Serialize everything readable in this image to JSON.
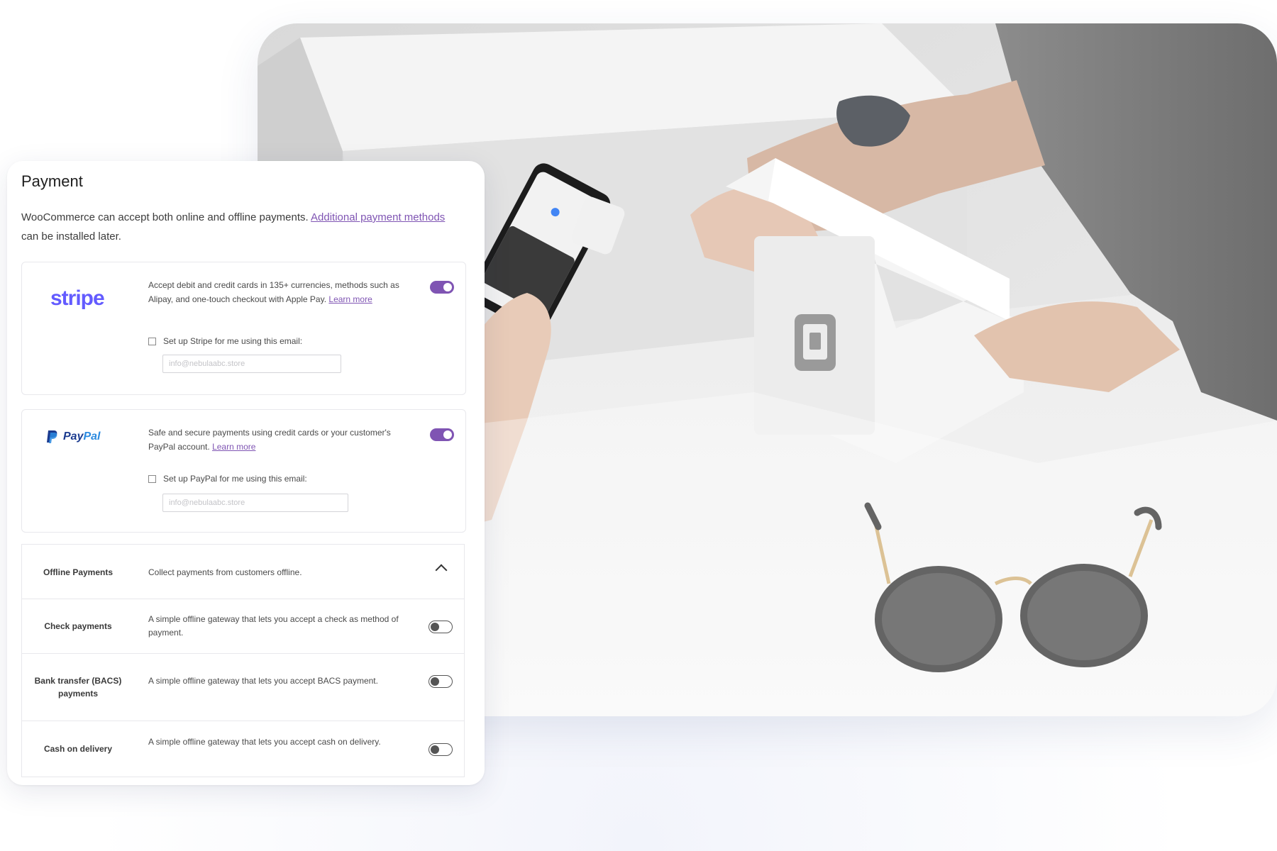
{
  "payment": {
    "title": "Payment",
    "intro_text": "WooCommerce can accept both online and offline payments.",
    "intro_link": "Additional payment methods",
    "intro_suffix": "can be installed later."
  },
  "stripe": {
    "logo": "stripe",
    "description": "Accept debit and credit cards in 135+ currencies, methods such as Alipay, and one-touch checkout with Apple Pay.",
    "learn_more": "Learn more",
    "enabled": true,
    "setup_label": "Set up Stripe for me using this email:",
    "email_placeholder": "info@nebulaabc.store"
  },
  "paypal": {
    "logo_pay": "Pay",
    "logo_pal": "Pal",
    "description": "Safe and secure payments using credit cards or your customer's PayPal account.",
    "learn_more": "Learn more",
    "enabled": true,
    "setup_label": "Set up PayPal for me using this email:",
    "email_placeholder": "info@nebulaabc.store"
  },
  "offline": {
    "label": "Offline Payments",
    "description": "Collect payments from customers offline.",
    "methods": [
      {
        "label": "Check payments",
        "description": "A simple offline gateway that lets you accept a check as method of payment.",
        "enabled": false
      },
      {
        "label": "Bank transfer (BACS) payments",
        "description": "A simple offline gateway that lets you accept BACS payment.",
        "enabled": false
      },
      {
        "label": "Cash on delivery",
        "description": "A simple offline gateway that lets you accept cash on delivery.",
        "enabled": false
      }
    ]
  },
  "colors": {
    "accent": "#7f54b3",
    "stripe": "#635bff",
    "paypal_dark": "#1b3b8f",
    "paypal_light": "#2c8be0"
  },
  "icons": {
    "collapse": "chevron-up-icon",
    "terminal": "square-logo-icon"
  }
}
